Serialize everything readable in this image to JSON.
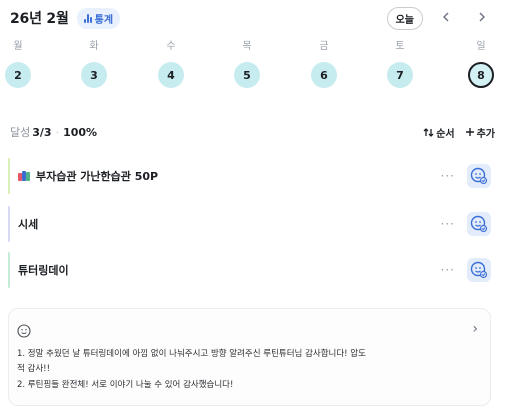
{
  "header": {
    "month": "26년 2월",
    "stats_label": "통계",
    "today_label": "오늘",
    "prev_icon": "chevron-left-icon",
    "next_icon": "chevron-right-icon"
  },
  "week": {
    "labels": [
      "월",
      "화",
      "수",
      "목",
      "금",
      "토",
      "일"
    ],
    "days": [
      "2",
      "3",
      "4",
      "5",
      "6",
      "7",
      "8"
    ],
    "selected_index": 6
  },
  "summary": {
    "label": "달성",
    "count": "3/3",
    "separator": "·",
    "percent": "100%",
    "order_label": "순서",
    "add_label": "추가"
  },
  "tasks": [
    {
      "title": "부자습관 가난한습관 50P",
      "bar_color": "#d9efb8",
      "has_book_icon": true
    },
    {
      "title": "시세",
      "bar_color": "#d8d9f2",
      "has_book_icon": false
    },
    {
      "title": "튜터링데이",
      "bar_color": "#c6ecd8",
      "has_book_icon": false
    }
  ],
  "task_more": "···",
  "memo": {
    "line1": "1. 정말 추웠던 날 튜터링데이에 아낌 없이 나눠주시고 방향 알려주신 루틴튜터님 감사합니다! 압도",
    "line2": "적 감사!!",
    "line3": "2. 루틴핑들 완전체! 서로 이야기 나눌 수 있어 감사했습니다!",
    "chevron": "›"
  },
  "colors": {
    "accent": "#3b6fd6",
    "day_circle": "#c7ecef",
    "check_bg": "#e3ecfb"
  }
}
